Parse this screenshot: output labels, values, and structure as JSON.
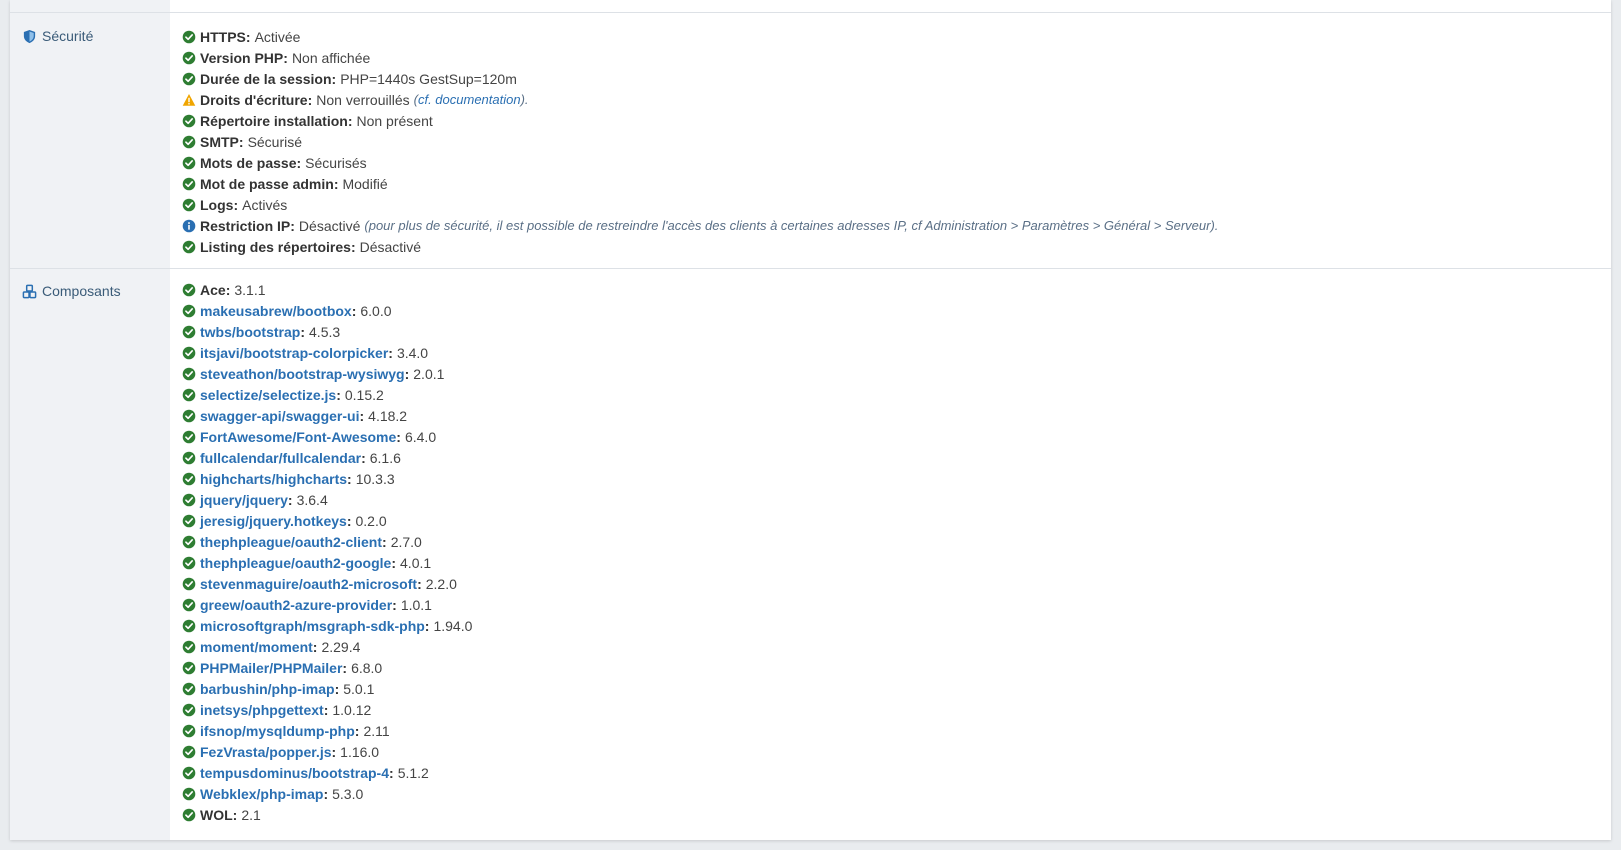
{
  "colors": {
    "ok": "#2e7d32",
    "warn": "#f0a500",
    "info": "#2a6fb2",
    "link": "#2a6fb2"
  },
  "security": {
    "label": "Sécurité",
    "icon": "shield-icon",
    "items": [
      {
        "key": "HTTPS",
        "value": "Activée",
        "status": "ok"
      },
      {
        "key": "Version PHP",
        "value": "Non affichée",
        "status": "ok"
      },
      {
        "key": "Durée de la session",
        "value": "PHP=1440s GestSup=120m",
        "status": "ok"
      },
      {
        "key": "Droits d'écriture",
        "value": "Non verrouillés",
        "status": "warn",
        "note_pre": "(",
        "note_link": "cf. documentation",
        "note_post": ")."
      },
      {
        "key": "Répertoire installation",
        "value": "Non présent",
        "status": "ok"
      },
      {
        "key": "SMTP",
        "value": "Sécurisé",
        "status": "ok"
      },
      {
        "key": "Mots de passe",
        "value": "Sécurisés",
        "status": "ok"
      },
      {
        "key": "Mot de passe admin",
        "value": "Modifié",
        "status": "ok"
      },
      {
        "key": "Logs",
        "value": "Activés",
        "status": "ok"
      },
      {
        "key": "Restriction IP",
        "value": "Désactivé",
        "status": "info",
        "note_text": "(pour plus de sécurité, il est possible de restreindre l'accès des clients à certaines adresses IP, cf Administration > Paramètres > Général > Serveur)."
      },
      {
        "key": "Listing des répertoires",
        "value": "Désactivé",
        "status": "ok"
      }
    ]
  },
  "components": {
    "label": "Composants",
    "icon": "cubes-icon",
    "items": [
      {
        "key": "Ace",
        "value": "3.1.1",
        "link": false
      },
      {
        "key": "makeusabrew/bootbox",
        "value": "6.0.0",
        "link": true
      },
      {
        "key": "twbs/bootstrap",
        "value": "4.5.3",
        "link": true
      },
      {
        "key": "itsjavi/bootstrap-colorpicker",
        "value": "3.4.0",
        "link": true
      },
      {
        "key": "steveathon/bootstrap-wysiwyg",
        "value": "2.0.1",
        "link": true
      },
      {
        "key": "selectize/selectize.js",
        "value": "0.15.2",
        "link": true
      },
      {
        "key": "swagger-api/swagger-ui",
        "value": "4.18.2",
        "link": true
      },
      {
        "key": "FortAwesome/Font-Awesome",
        "value": "6.4.0",
        "link": true
      },
      {
        "key": "fullcalendar/fullcalendar",
        "value": "6.1.6",
        "link": true
      },
      {
        "key": "highcharts/highcharts",
        "value": "10.3.3",
        "link": true
      },
      {
        "key": "jquery/jquery",
        "value": "3.6.4",
        "link": true
      },
      {
        "key": "jeresig/jquery.hotkeys",
        "value": "0.2.0",
        "link": true
      },
      {
        "key": "thephpleague/oauth2-client",
        "value": "2.7.0",
        "link": true
      },
      {
        "key": "thephpleague/oauth2-google",
        "value": "4.0.1",
        "link": true
      },
      {
        "key": "stevenmaguire/oauth2-microsoft",
        "value": "2.2.0",
        "link": true
      },
      {
        "key": "greew/oauth2-azure-provider",
        "value": "1.0.1",
        "link": true
      },
      {
        "key": "microsoftgraph/msgraph-sdk-php",
        "value": "1.94.0",
        "link": true
      },
      {
        "key": "moment/moment",
        "value": "2.29.4",
        "link": true
      },
      {
        "key": "PHPMailer/PHPMailer",
        "value": "6.8.0",
        "link": true
      },
      {
        "key": "barbushin/php-imap",
        "value": "5.0.1",
        "link": true
      },
      {
        "key": "inetsys/phpgettext",
        "value": "1.0.12",
        "link": true
      },
      {
        "key": "ifsnop/mysqldump-php",
        "value": "2.11",
        "link": true
      },
      {
        "key": "FezVrasta/popper.js",
        "value": "1.16.0",
        "link": true
      },
      {
        "key": "tempusdominus/bootstrap-4",
        "value": "5.1.2",
        "link": true
      },
      {
        "key": "Webklex/php-imap",
        "value": "5.3.0",
        "link": true
      },
      {
        "key": "WOL",
        "value": "2.1",
        "link": false
      }
    ]
  }
}
